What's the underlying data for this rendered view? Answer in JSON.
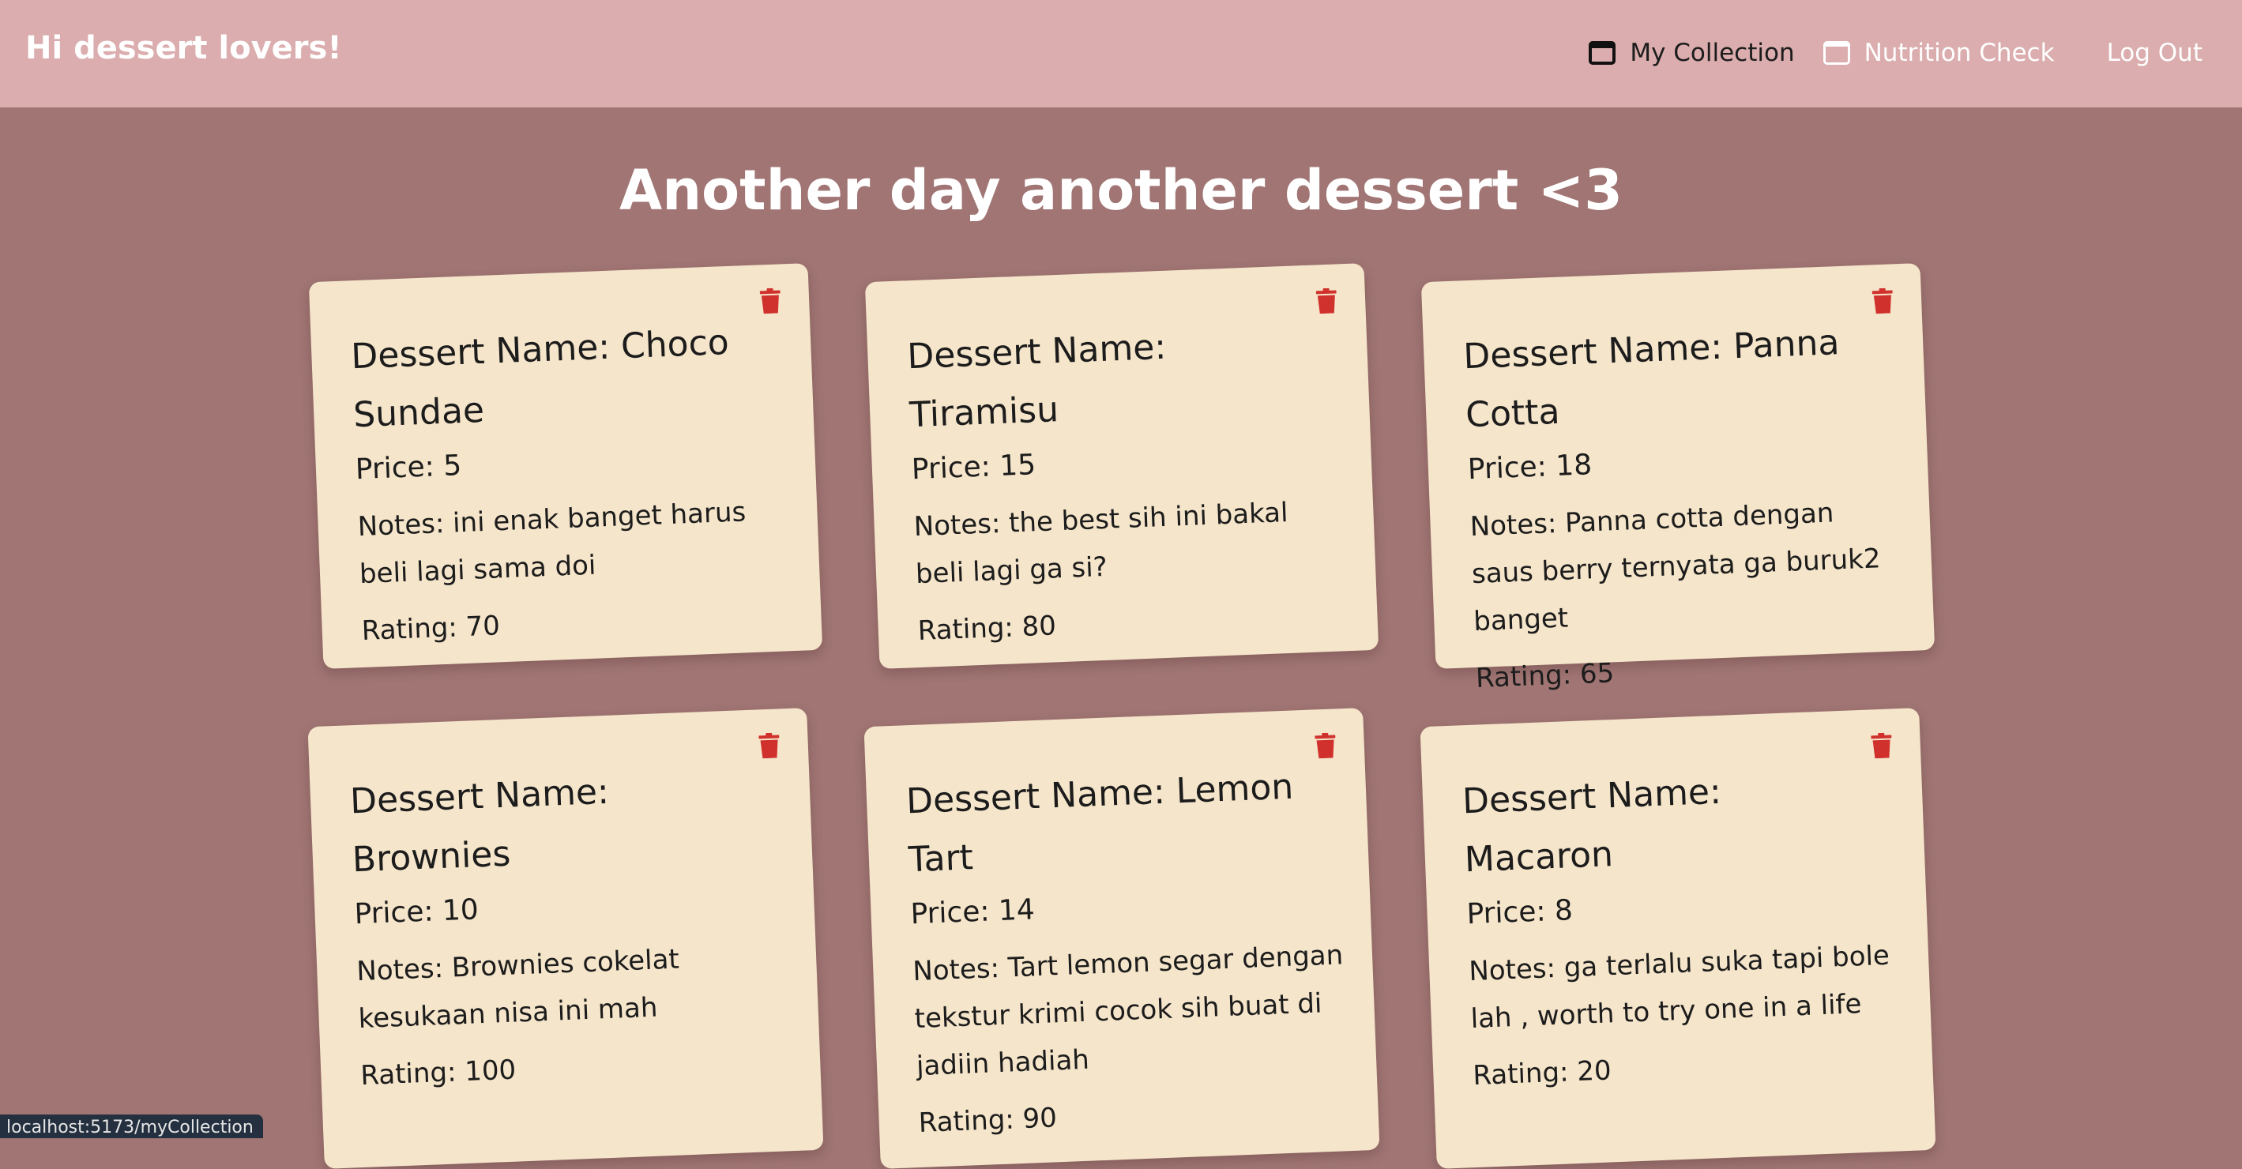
{
  "header": {
    "brand": "Hi dessert lovers!",
    "nav": [
      {
        "label": "My Collection",
        "icon": "window-icon"
      },
      {
        "label": "Nutrition Check",
        "icon": "window-icon"
      }
    ],
    "logout_label": "Log Out"
  },
  "main": {
    "title": "Another day another dessert <3",
    "cards": [
      {
        "name": "Dessert Name: Choco Sundae",
        "price": "Price: 5",
        "notes": "Notes: ini enak banget harus beli lagi sama doi",
        "rating": "Rating: 70"
      },
      {
        "name": "Dessert Name: Tiramisu",
        "price": "Price: 15",
        "notes": "Notes: the best sih ini bakal beli lagi ga si?",
        "rating": "Rating: 80"
      },
      {
        "name": "Dessert Name: Panna Cotta",
        "price": "Price: 18",
        "notes": "Notes: Panna cotta dengan saus berry ternyata ga buruk2 banget",
        "rating": "Rating: 65"
      },
      {
        "name": "Dessert Name: Brownies",
        "price": "Price: 10",
        "notes": "Notes: Brownies cokelat kesukaan nisa ini mah",
        "rating": "Rating: 100"
      },
      {
        "name": "Dessert Name: Lemon Tart",
        "price": "Price: 14",
        "notes": "Notes: Tart lemon segar dengan tekstur krimi cocok sih buat di jadiin hadiah",
        "rating": "Rating: 90"
      },
      {
        "name": "Dessert Name: Macaron",
        "price": "Price: 8",
        "notes": "Notes: ga terlalu suka tapi bole lah , worth to try one in a life",
        "rating": "Rating: 20"
      }
    ]
  },
  "status_bar": {
    "url": "localhost:5173/myCollection"
  },
  "colors": {
    "header_bg": "#dbadae",
    "page_bg": "#a07573",
    "card_bg": "#f5e5ca",
    "trash_icon": "#d0312d"
  }
}
